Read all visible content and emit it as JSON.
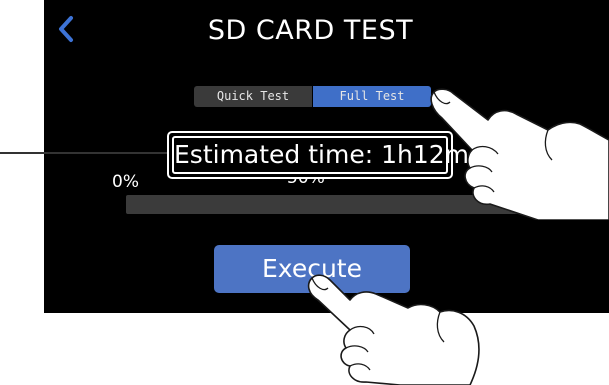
{
  "header": {
    "title": "SD CARD TEST",
    "back_icon": "chevron-left-icon"
  },
  "test_tabs": [
    {
      "label": "Quick Test",
      "selected": false
    },
    {
      "label": "Full Test",
      "selected": true
    }
  ],
  "progress": {
    "start_label": "0%",
    "mid_label": "50%",
    "value_percent": 0
  },
  "execute_label": "Execute",
  "callout": {
    "text": "Estimated time: 1h12m"
  },
  "colors": {
    "accent": "#4d74c4",
    "tab_selected": "#3f6fc8",
    "tab_unselected": "#3a3a3a",
    "screen_bg": "#000000"
  }
}
